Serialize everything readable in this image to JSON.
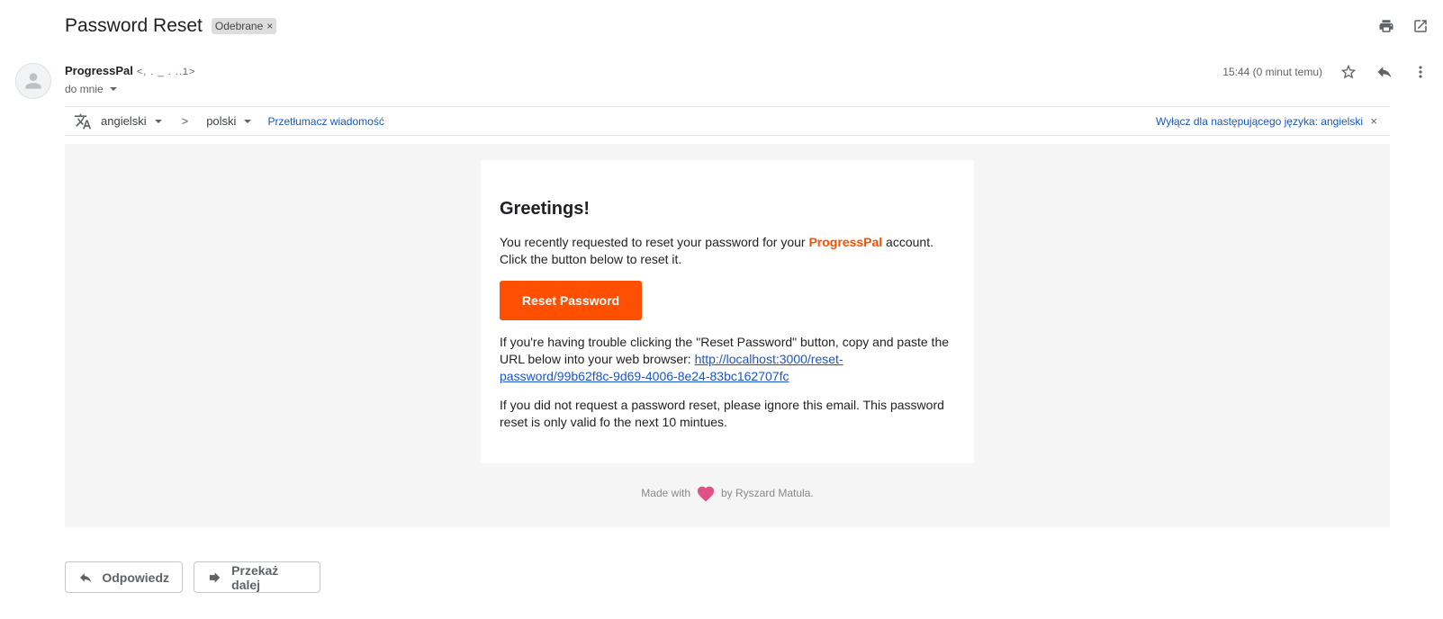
{
  "header": {
    "subject": "Password Reset",
    "label_chip": "Odebrane",
    "label_remove": "×"
  },
  "sender": {
    "name": "ProgressPal",
    "email_masked": "<,                 .  _      .    ..1>",
    "to_label": "do mnie"
  },
  "meta": {
    "time": "15:44 (0 minut temu)"
  },
  "translate": {
    "source_lang": "angielski",
    "separator": ">",
    "target_lang": "polski",
    "translate_link": "Przetłumacz wiadomość",
    "disable_link": "Wyłącz dla następującego języka: angielski",
    "close": "×"
  },
  "email": {
    "greeting": "Greetings!",
    "p1_before": "You recently requested to reset your password for your ",
    "brand": "ProgressPal",
    "p1_after": " account. Click the button below to reset it.",
    "button_label": "Reset Password",
    "p2_before": "If you're having trouble clicking the \"Reset Password\" button, copy and paste the URL below into your web browser: ",
    "reset_url": "http://localhost:3000/reset-password/99b62f8c-9d69-4006-8e24-83bc162707fc",
    "p3": "If you did not request a password reset, please ignore this email. This password reset is only valid fo the next 10 mintues.",
    "footer_before": "Made with",
    "footer_after": "by Ryszard Matula."
  },
  "actions": {
    "reply": "Odpowiedz",
    "forward": "Przekaż dalej"
  },
  "colors": {
    "brand": "#ff4f00",
    "link": "#1a56c6",
    "heart": "#e0508a"
  },
  "icons": [
    "print-icon",
    "open-in-new-window-icon",
    "star-icon",
    "reply-icon",
    "more-vert-icon",
    "translate-icon",
    "person-icon",
    "heart-icon",
    "forward-icon"
  ]
}
